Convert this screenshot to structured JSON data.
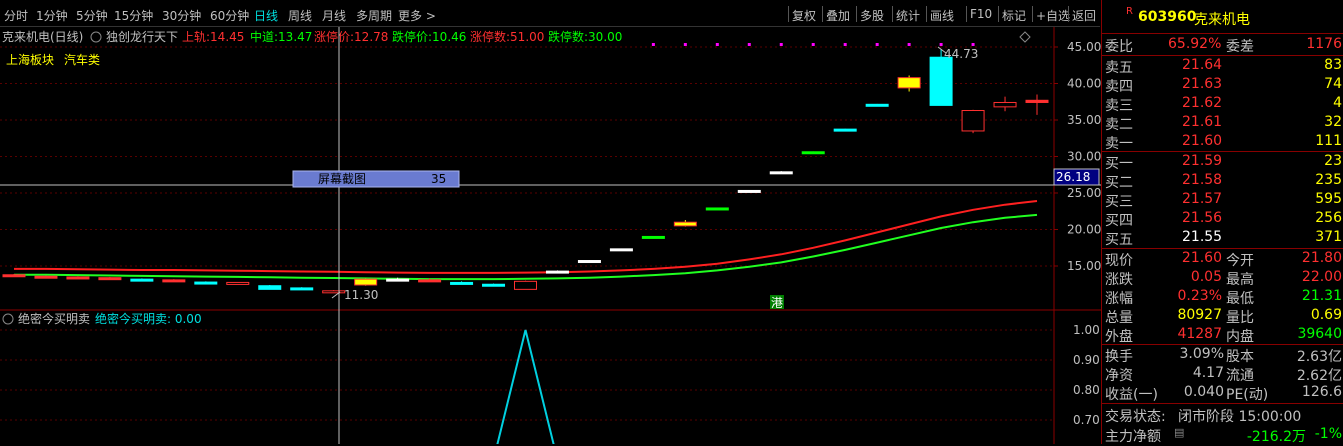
{
  "toolbar": {
    "periods": [
      "分时",
      "1分钟",
      "5分钟",
      "15分钟",
      "30分钟",
      "60分钟",
      "日线",
      "周线",
      "月线",
      "多周期",
      "更多 >"
    ],
    "active_period": "日线",
    "actions": [
      "复权",
      "叠加",
      "多股",
      "统计",
      "画线",
      "F10",
      "标记",
      "+自选",
      "返回"
    ]
  },
  "header": {
    "stock": "克来机电(日线)",
    "indicator": "独创龙行天下",
    "items": [
      {
        "label": "上轨:",
        "value": "14.45",
        "color": "#ff3030"
      },
      {
        "label": "中道:",
        "value": "13.47",
        "color": "#00ff00"
      },
      {
        "label": "涨停价:",
        "value": "12.78",
        "color": "#ff3030"
      },
      {
        "label": "跌停价:",
        "value": "10.46",
        "color": "#00ff00"
      },
      {
        "label": "涨停数:",
        "value": "51.00",
        "color": "#ff3030"
      },
      {
        "label": "跌停数:",
        "value": "30.00",
        "color": "#00ff00"
      }
    ],
    "sector1": "上海板块",
    "sector2": "汽车类"
  },
  "annotations": {
    "high_label": "44.73",
    "low_label": "11.30",
    "crosshair_price": "26.18",
    "screenshot_label": "屏幕截图",
    "screenshot_value": "35",
    "gang": "港"
  },
  "sub": {
    "title": "绝密今买明卖",
    "series": "绝密今买明卖: 0.00",
    "ticks": [
      "1.00",
      "0.90",
      "0.80",
      "0.70"
    ]
  },
  "chart_data": {
    "type": "candlestick",
    "y_axis_ticks": [
      45.0,
      40.0,
      35.0,
      30.0,
      25.0,
      20.0,
      15.0
    ],
    "ylim": [
      10.5,
      46.5
    ],
    "candles": [
      [
        13.8,
        13.9,
        13.7,
        13.75
      ],
      [
        13.6,
        13.7,
        13.5,
        13.55
      ],
      [
        13.5,
        13.6,
        13.4,
        13.45
      ],
      [
        13.4,
        13.5,
        13.3,
        13.35
      ],
      [
        13.2,
        13.3,
        13.1,
        13.15
      ],
      [
        13.1,
        13.2,
        13.0,
        13.05
      ],
      [
        12.8,
        12.9,
        12.6,
        12.7
      ],
      [
        12.6,
        12.8,
        12.5,
        12.75
      ],
      [
        12.3,
        12.4,
        11.9,
        11.8
      ],
      [
        12.0,
        12.1,
        11.9,
        11.95
      ],
      [
        11.5,
        11.7,
        11.3,
        11.6
      ],
      [
        12.4,
        13.3,
        12.3,
        13.2
      ],
      [
        13.0,
        13.4,
        12.9,
        13.2
      ],
      [
        13.1,
        13.3,
        13.0,
        13.05
      ],
      [
        12.7,
        12.9,
        12.6,
        12.75
      ],
      [
        12.5,
        12.6,
        12.2,
        12.3
      ],
      [
        11.8,
        13.0,
        11.8,
        12.9
      ],
      [
        14.1,
        14.4,
        14.0,
        14.3
      ],
      [
        15.7,
        15.8,
        15.6,
        15.75
      ],
      [
        17.3,
        17.4,
        17.2,
        17.35
      ],
      [
        19.0,
        19.1,
        18.9,
        19.05
      ],
      [
        20.5,
        21.3,
        20.4,
        21.0
      ],
      [
        22.9,
        23.0,
        22.8,
        22.95
      ],
      [
        25.3,
        25.4,
        25.2,
        25.35
      ],
      [
        27.8,
        28.0,
        27.7,
        27.9
      ],
      [
        30.6,
        30.7,
        30.5,
        30.65
      ],
      [
        33.7,
        33.8,
        33.6,
        33.75
      ],
      [
        37.1,
        37.2,
        37.0,
        37.15
      ],
      [
        39.4,
        41.1,
        38.9,
        40.8
      ],
      [
        43.6,
        44.73,
        37.0,
        37.0
      ],
      [
        33.5,
        36.4,
        33.2,
        36.3
      ],
      [
        36.8,
        38.2,
        36.2,
        37.4
      ],
      [
        37.7,
        38.5,
        35.7,
        37.4
      ]
    ],
    "candle_colors": [
      "#ff3030",
      "#ff3030",
      "#ff3030",
      "#ff3030",
      "#00ffff",
      "#ff3030",
      "#00ffff",
      "#ff3030",
      "#00ffff",
      "#00ffff",
      "#ff3030",
      "#ffff00",
      "#ffffff",
      "#ff3030",
      "#00ffff",
      "#00ffff",
      "#ff3030",
      "#ffffff",
      "#ffffff",
      "#ffffff",
      "#00ff00",
      "#ffff00",
      "#00ff00",
      "#ffffff",
      "#ffffff",
      "#00ff00",
      "#00ffff",
      "#00ffff",
      "#ffff00",
      "#00ffff",
      "#ff3030",
      "#ff3030",
      "#ff3030"
    ],
    "upper_band": [
      14.6,
      14.6,
      14.55,
      14.5,
      14.45,
      14.45,
      14.4,
      14.35,
      14.3,
      14.25,
      14.2,
      14.15,
      14.1,
      14.05,
      14.05,
      14.05,
      14.1,
      14.15,
      14.25,
      14.4,
      14.6,
      14.9,
      15.3,
      15.9,
      16.6,
      17.5,
      18.5,
      19.6,
      20.7,
      21.8,
      22.7,
      23.4,
      23.9
    ],
    "middle_band": [
      13.8,
      13.8,
      13.75,
      13.7,
      13.65,
      13.6,
      13.55,
      13.5,
      13.45,
      13.4,
      13.35,
      13.3,
      13.25,
      13.2,
      13.2,
      13.2,
      13.25,
      13.3,
      13.4,
      13.55,
      13.75,
      14.0,
      14.4,
      14.9,
      15.5,
      16.3,
      17.2,
      18.2,
      19.2,
      20.2,
      21.0,
      21.6,
      22.0
    ],
    "sub_values": [
      0,
      0,
      0,
      0,
      0,
      0,
      0,
      0,
      0,
      0,
      0,
      0,
      0,
      0,
      0,
      0,
      1,
      0,
      0,
      0,
      0,
      0,
      0,
      0,
      0,
      0,
      0,
      0,
      0,
      0,
      0,
      0,
      0
    ],
    "sub_ylim": [
      0.65,
      1.05
    ]
  },
  "quote": {
    "code": "603960",
    "name": "克来机电",
    "wei_bi": {
      "label": "委比",
      "value": "65.92%",
      "label2": "委差",
      "value2": "1176"
    },
    "asks": [
      {
        "label": "卖五",
        "price": "21.64",
        "vol": "83"
      },
      {
        "label": "卖四",
        "price": "21.63",
        "vol": "74"
      },
      {
        "label": "卖三",
        "price": "21.62",
        "vol": "4"
      },
      {
        "label": "卖二",
        "price": "21.61",
        "vol": "32"
      },
      {
        "label": "卖一",
        "price": "21.60",
        "vol": "111"
      }
    ],
    "bids": [
      {
        "label": "买一",
        "price": "21.59",
        "vol": "23"
      },
      {
        "label": "买二",
        "price": "21.58",
        "vol": "235"
      },
      {
        "label": "买三",
        "price": "21.57",
        "vol": "595"
      },
      {
        "label": "买四",
        "price": "21.56",
        "vol": "256"
      },
      {
        "label": "买五",
        "price": "21.55",
        "vol": "371"
      }
    ],
    "stats": [
      {
        "l1": "现价",
        "v1": "21.60",
        "c1": "#ff3030",
        "l2": "今开",
        "v2": "21.80",
        "c2": "#ff3030"
      },
      {
        "l1": "涨跌",
        "v1": "0.05",
        "c1": "#ff3030",
        "l2": "最高",
        "v2": "22.00",
        "c2": "#ff3030"
      },
      {
        "l1": "涨幅",
        "v1": "0.23%",
        "c1": "#ff3030",
        "l2": "最低",
        "v2": "21.31",
        "c2": "#00ff00"
      },
      {
        "l1": "总量",
        "v1": "80927",
        "c1": "#ffff00",
        "l2": "量比",
        "v2": "0.69",
        "c2": "#ffff00"
      },
      {
        "l1": "外盘",
        "v1": "41287",
        "c1": "#ff3030",
        "l2": "内盘",
        "v2": "39640",
        "c2": "#00ff00"
      }
    ],
    "fund": [
      {
        "l1": "换手",
        "v1": "3.09%",
        "l2": "股本",
        "v2": "2.63亿"
      },
      {
        "l1": "净资",
        "v1": "4.17",
        "l2": "流通",
        "v2": "2.62亿"
      },
      {
        "l1": "收益(一)",
        "v1": "0.040",
        "l2": "PE(动)",
        "v2": "126.6"
      }
    ],
    "status_label": "交易状态:",
    "status_value": "闭市阶段 15:00:00",
    "flow_label": "主力净额",
    "flow_value": "-216.2万",
    "flow_pct": "-1%"
  }
}
